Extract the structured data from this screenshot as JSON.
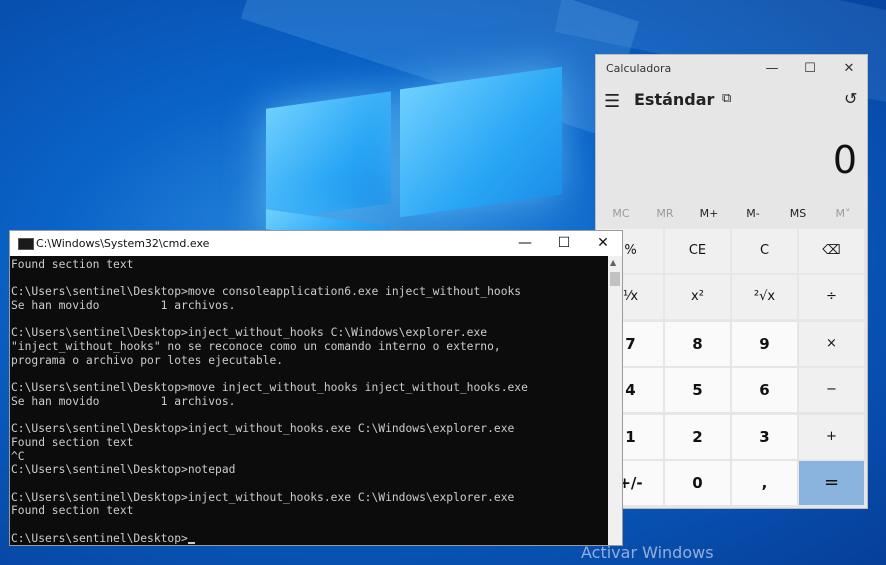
{
  "desktop": {
    "watermark": "Activar Windows"
  },
  "calculator": {
    "window_title": "Calculadora",
    "window_controls": {
      "minimize": "—",
      "maximize": "☐",
      "close": "✕"
    },
    "hamburger": "☰",
    "mode": "Estándar",
    "keep_on_top": "⧉",
    "history_icon": "↺",
    "display": "0",
    "memory": [
      "MC",
      "MR",
      "M+",
      "M-",
      "MS",
      "M˅"
    ],
    "keys": [
      [
        "%",
        "CE",
        "C",
        "⌫"
      ],
      [
        "¹⁄x",
        "x²",
        "²√x",
        "÷"
      ],
      [
        "7",
        "8",
        "9",
        "×"
      ],
      [
        "4",
        "5",
        "6",
        "−"
      ],
      [
        "1",
        "2",
        "3",
        "+"
      ],
      [
        "+/-",
        "0",
        ",",
        "="
      ]
    ]
  },
  "cmd": {
    "window_title": "C:\\Windows\\System32\\cmd.exe",
    "window_controls": {
      "minimize": "—",
      "maximize": "☐",
      "close": "✕"
    },
    "lines": [
      "Found section text",
      "",
      "C:\\Users\\sentinel\\Desktop>move consoleapplication6.exe inject_without_hooks",
      "Se han movido         1 archivos.",
      "",
      "C:\\Users\\sentinel\\Desktop>inject_without_hooks C:\\Windows\\explorer.exe",
      "\"inject_without_hooks\" no se reconoce como un comando interno o externo,",
      "programa o archivo por lotes ejecutable.",
      "",
      "C:\\Users\\sentinel\\Desktop>move inject_without_hooks inject_without_hooks.exe",
      "Se han movido         1 archivos.",
      "",
      "C:\\Users\\sentinel\\Desktop>inject_without_hooks.exe C:\\Windows\\explorer.exe",
      "Found section text",
      "^C",
      "C:\\Users\\sentinel\\Desktop>notepad",
      "",
      "C:\\Users\\sentinel\\Desktop>inject_without_hooks.exe C:\\Windows\\explorer.exe",
      "Found section text",
      "",
      "C:\\Users\\sentinel\\Desktop>"
    ]
  }
}
